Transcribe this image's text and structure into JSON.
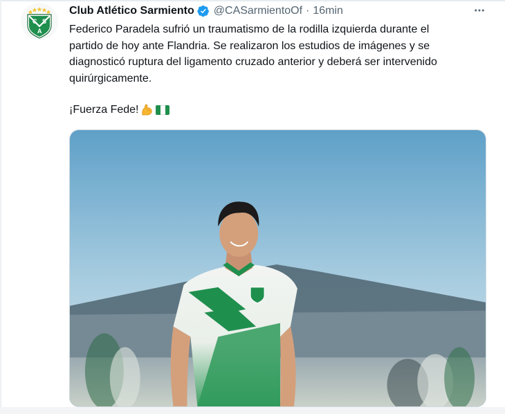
{
  "tweet": {
    "author": {
      "name": "Club Atlético Sarmiento",
      "handle": "@CASarmientoOf",
      "verified": true,
      "avatar_icon": "club-crest-icon"
    },
    "separator": "·",
    "time": "16min",
    "text_lines": [
      "Federico Paradela sufrió un traumatismo de la rodilla izquierda durante el",
      "partido de hoy ante Flandria. Se realizaron los estudios de imágenes y se",
      "diagnosticó ruptura del ligamento cruzado anterior y deberá ser intervenido",
      "quirúrgicamente."
    ],
    "closing_line": "¡Fuerza Fede!",
    "closing_emojis": [
      "flexed-biceps-icon",
      "green-white-flag-icon"
    ],
    "more_icon": "more-options-icon"
  },
  "crest": {
    "letters": [
      "C",
      "S",
      "A"
    ]
  },
  "colors": {
    "club_green": "#1f8f4e",
    "verified_blue": "#1d9bf0",
    "text": "#0f1419",
    "secondary_text": "#536471"
  }
}
